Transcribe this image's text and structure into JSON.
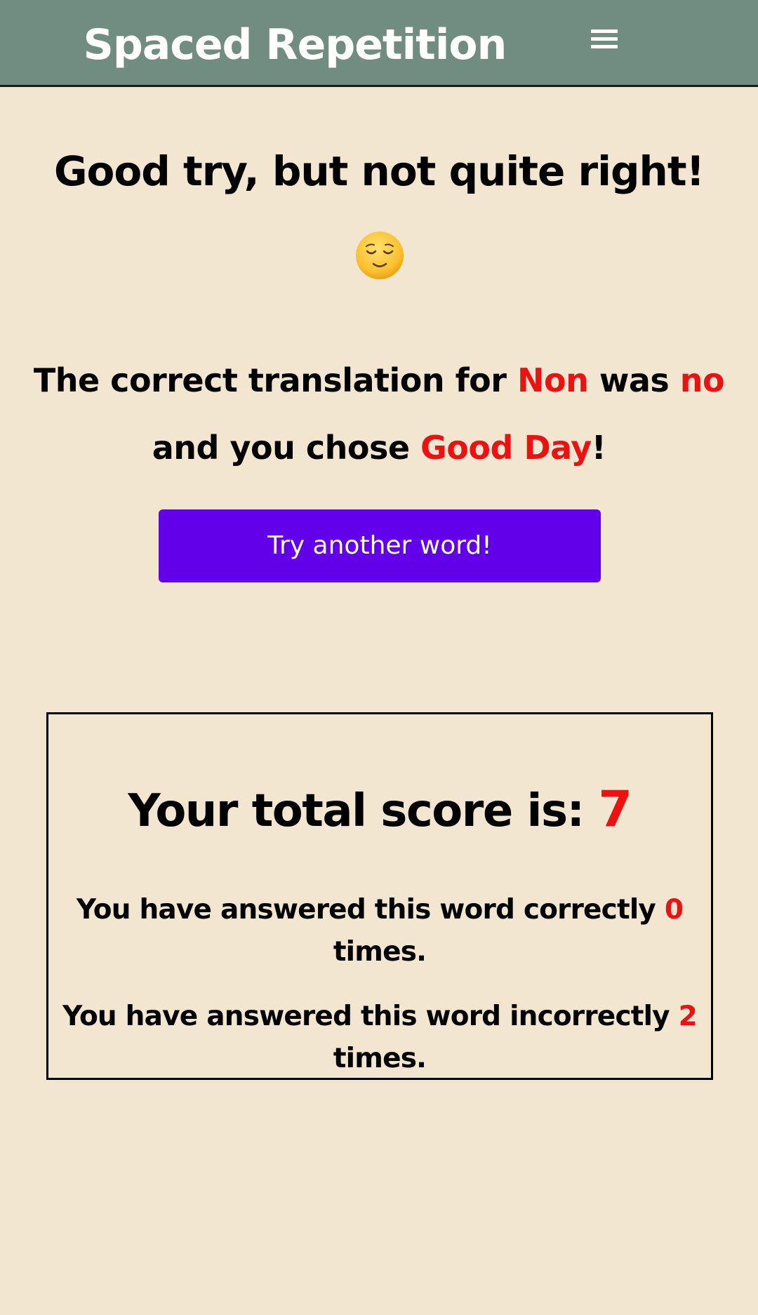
{
  "header": {
    "title": "Spaced Repetition",
    "menu_icon": "hamburger-menu-icon"
  },
  "feedback": {
    "heading": "Good try, but not quite right!",
    "emoji_icon": "relieved-face-icon"
  },
  "result": {
    "prefix": "The correct translation for ",
    "word": "Non",
    "middle": " was ",
    "correct_answer": "no",
    "middle2": " and you chose ",
    "chosen_answer": "Good Day",
    "suffix": "!"
  },
  "actions": {
    "try_another_label": "Try another word!"
  },
  "score": {
    "label": "Your total score is: ",
    "total": "7",
    "correct_prefix": "You have answered this word correctly ",
    "correct_count": "0",
    "correct_suffix": " times.",
    "incorrect_prefix": "You have answered this word incorrectly ",
    "incorrect_count": "2",
    "incorrect_suffix": " times."
  },
  "colors": {
    "header_bg": "#718d81",
    "page_bg": "#f2e6d1",
    "accent_red": "#ee1111",
    "button_bg": "#6200ea"
  }
}
